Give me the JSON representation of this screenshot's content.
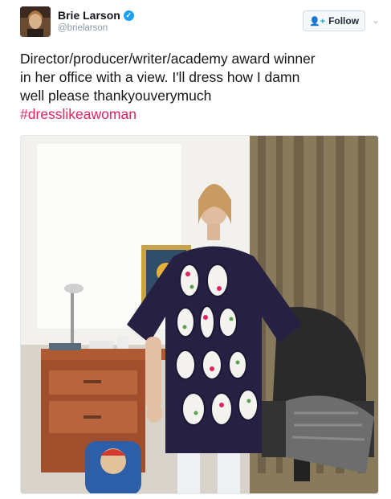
{
  "author": {
    "display_name": "Brie Larson",
    "handle": "@brielarson",
    "verified_icon": "verified-badge-icon"
  },
  "follow_button": {
    "label": "Follow",
    "icon": "add-user-icon"
  },
  "more_menu_icon": "chevron-down-icon",
  "tweet": {
    "text": "Director/producer/writer/academy award winner\nin her office with a view. I'll dress how I damn\nwell please thankyouverymuch",
    "hashtag": "#dresslikeawoman"
  },
  "colors": {
    "brand_blue": "#1da1f2",
    "hashtag": "#e0245e",
    "text": "#14171a",
    "secondary_text": "#8899a6"
  }
}
